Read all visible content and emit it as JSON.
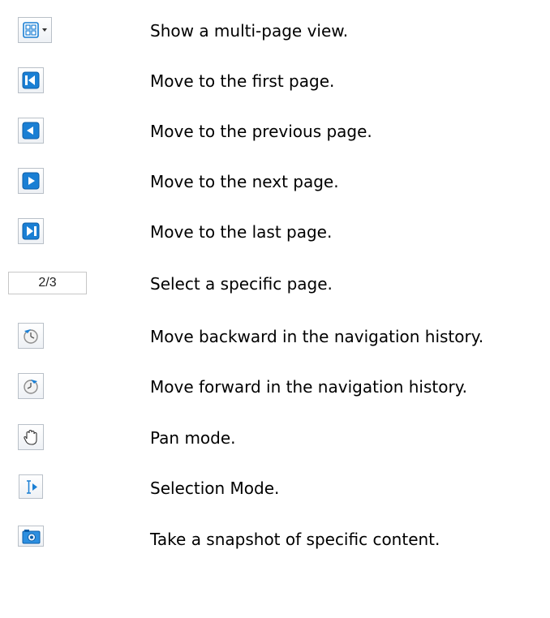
{
  "items": [
    {
      "icon": "multi-page-view-icon",
      "text": "Show a multi-page view."
    },
    {
      "icon": "first-page-icon",
      "text": "Move to the first page."
    },
    {
      "icon": "previous-page-icon",
      "text": "Move to the previous page."
    },
    {
      "icon": "next-page-icon",
      "text": "Move to the next page."
    },
    {
      "icon": "last-page-icon",
      "text": "Move to the last page."
    },
    {
      "icon": "page-number-field",
      "value": "2/3",
      "text": "Select a specific page."
    },
    {
      "icon": "history-back-icon",
      "text": "Move backward in the navigation history."
    },
    {
      "icon": "history-forward-icon",
      "text": "Move forward in the navigation history."
    },
    {
      "icon": "pan-hand-icon",
      "text": "Pan mode."
    },
    {
      "icon": "selection-mode-icon",
      "text": "Selection Mode."
    },
    {
      "icon": "snapshot-icon",
      "text": "Take a snapshot of specific content."
    }
  ],
  "colors": {
    "blue": "#1a7fd4",
    "blue_dark": "#0b5ea8",
    "border": "#b9c0c8"
  }
}
